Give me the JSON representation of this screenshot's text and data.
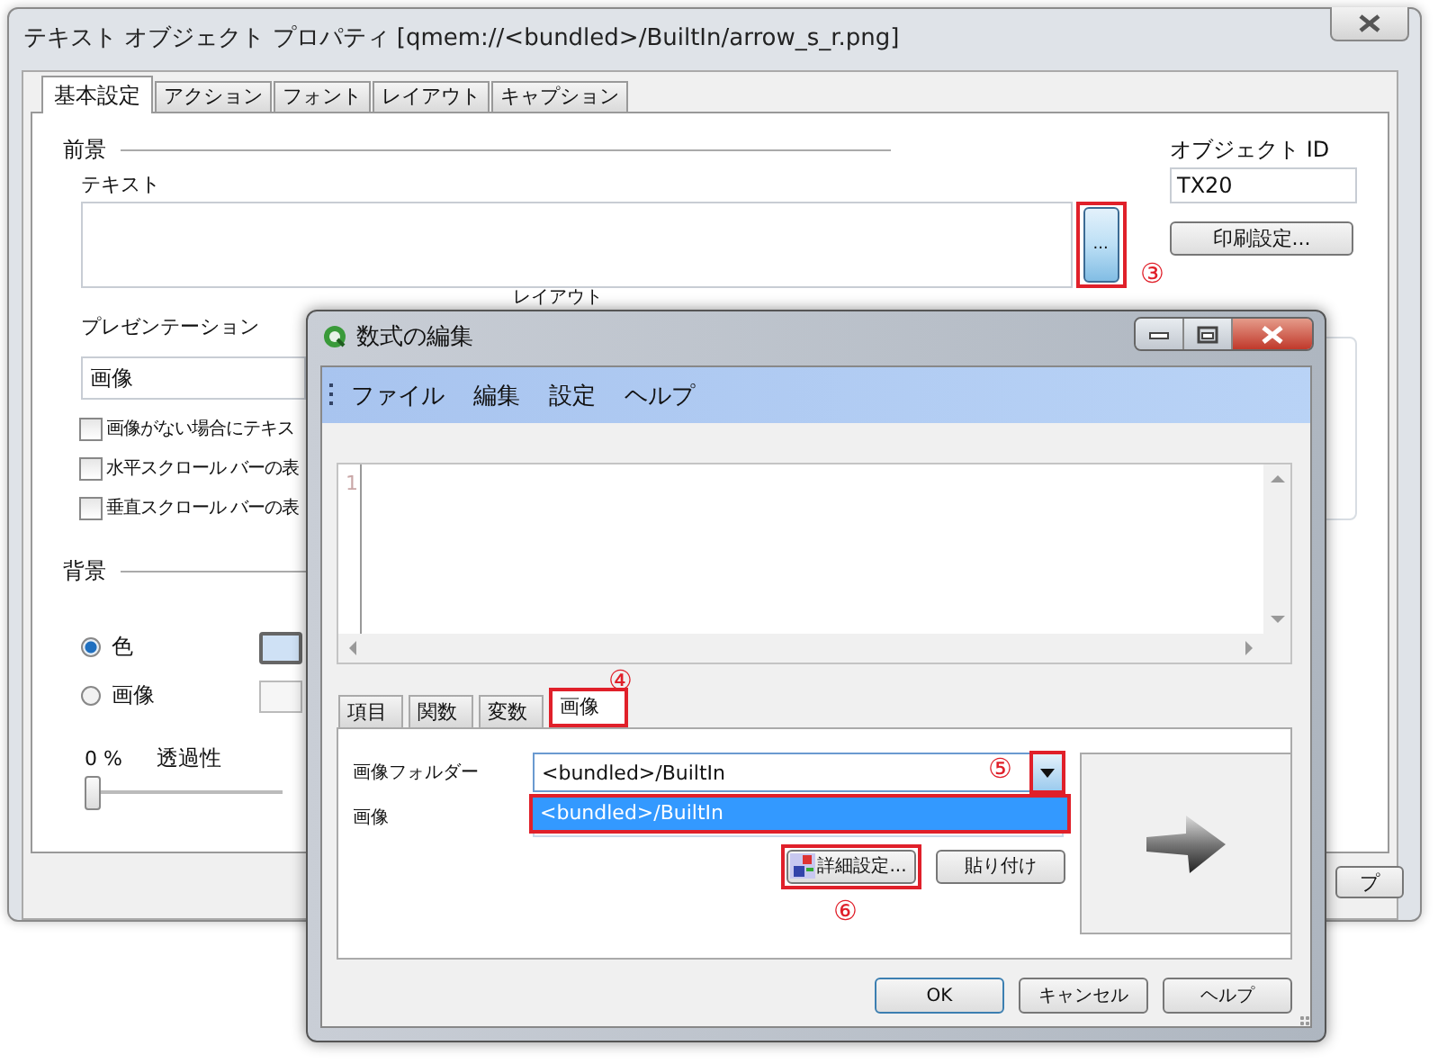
{
  "background_window": {
    "title": "テキスト オブジェクト プロパティ [qmem://<bundled>/BuiltIn/arrow_s_r.png]",
    "tabs": [
      {
        "label": "基本設定",
        "selected": true
      },
      {
        "label": "アクション",
        "selected": false
      },
      {
        "label": "フォント",
        "selected": false
      },
      {
        "label": "レイアウト",
        "selected": false
      },
      {
        "label": "キャプション",
        "selected": false
      }
    ],
    "foreground_heading": "前景",
    "text_label": "テキスト",
    "expand_button": "...",
    "object_id": {
      "label": "オブジェクト ID",
      "value": "TX20"
    },
    "print_button": "印刷設定...",
    "presentation": {
      "label": "プレゼンテーション",
      "value": "画像"
    },
    "layout_label": "レイアウト",
    "checkboxes": [
      {
        "label": "画像がない場合にテキス",
        "checked": false
      },
      {
        "label": "水平スクロール バーの表",
        "checked": false
      },
      {
        "label": "垂直スクロール バーの表",
        "checked": false
      }
    ],
    "background_heading": "背景",
    "background_options": [
      {
        "label": "色",
        "selected": true
      },
      {
        "label": "画像",
        "selected": false
      }
    ],
    "transparency": {
      "value": "0 %",
      "label": "透過性",
      "level": 0
    },
    "help_button": "プ"
  },
  "editor_window": {
    "title": "数式の編集",
    "menu": [
      "ファイル",
      "編集",
      "設定",
      "ヘルプ"
    ],
    "line_numbers": [
      "1"
    ],
    "tabs": [
      {
        "label": "項目",
        "selected": false
      },
      {
        "label": "関数",
        "selected": false
      },
      {
        "label": "変数",
        "selected": false
      },
      {
        "label": "画像",
        "selected": true
      }
    ],
    "image_folder": {
      "label": "画像フォルダー",
      "value": "<bundled>/BuiltIn",
      "options": [
        {
          "label": "<bundled>/BuiltIn",
          "selected": true
        }
      ]
    },
    "image_label": "画像",
    "advanced_button": "詳細設定...",
    "paste_button": "貼り付け",
    "buttons": [
      "OK",
      "キャンセル",
      "ヘルプ"
    ]
  },
  "annotations": [
    "③",
    "④",
    "⑤",
    "⑥"
  ]
}
